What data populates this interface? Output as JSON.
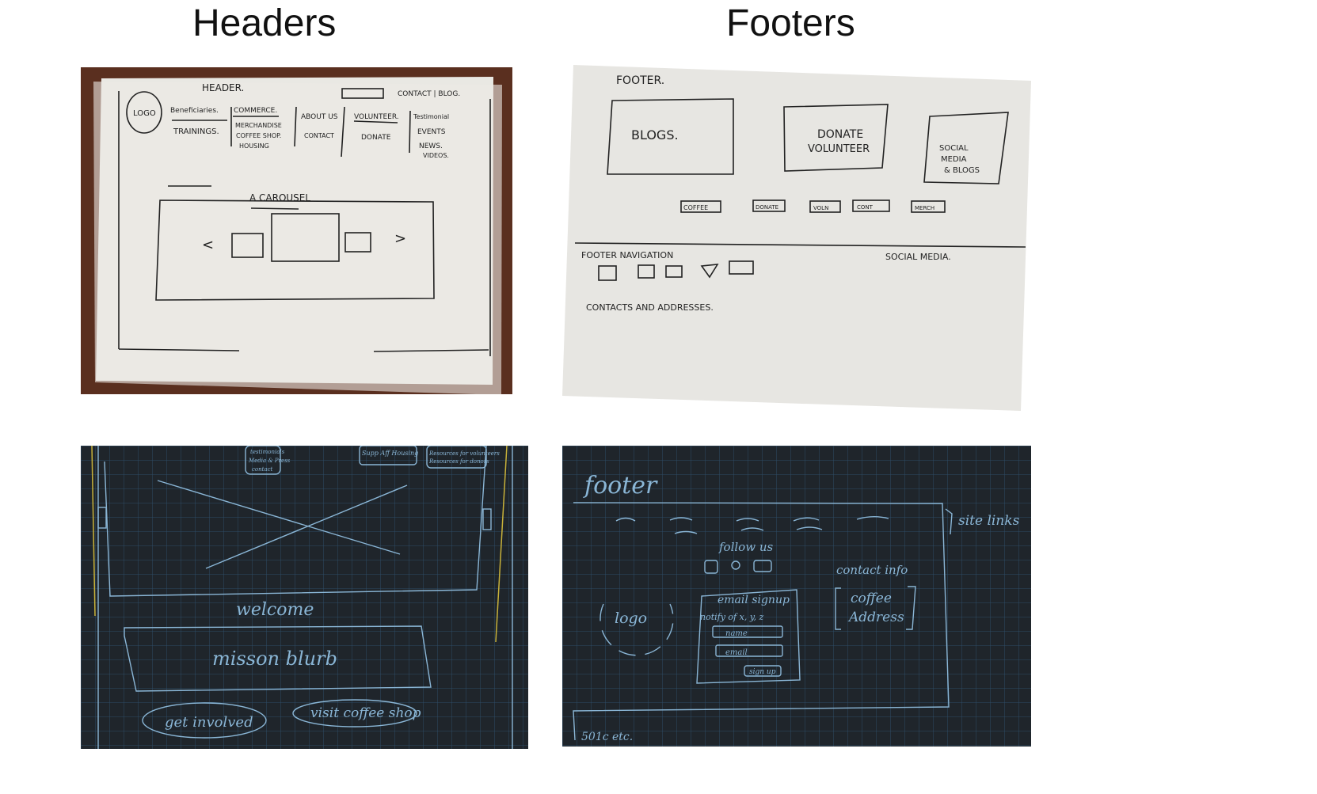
{
  "columns": {
    "left_title": "Headers",
    "right_title": "Footers"
  },
  "header_paper": {
    "title": "HEADER.",
    "logo": "LOGO",
    "top_links": "CONTACT | BLOG.",
    "nav": {
      "col1": [
        "Beneficiaries.",
        "TRAININGS."
      ],
      "col2": [
        "COMMERCE.",
        "MERCHANDISE",
        "COFFEE SHOP.",
        "HOUSING"
      ],
      "col3": [
        "ABOUT US",
        "CONTACT"
      ],
      "col4": [
        "VOLUNTEER.",
        "DONATE"
      ],
      "col5": [
        "Testimonial",
        "EVENTS",
        "NEWS.",
        "VIDEOS."
      ]
    },
    "carousel_label": "A CAROUSEL",
    "prev_arrow": "<",
    "next_arrow": ">"
  },
  "footer_paper": {
    "title": "FOOTER.",
    "box_blogs": "BLOGS.",
    "box_donate": [
      "DONATE",
      "VOLUNTEER"
    ],
    "box_social": [
      "SOCIAL",
      "MEDIA",
      "& BLOGS"
    ],
    "small_buttons": [
      "COFFEE",
      "DONATE",
      "VOLN",
      "CONT",
      "MERCH"
    ],
    "nav_label": "FOOTER NAVIGATION",
    "social_label": "SOCIAL MEDIA.",
    "contacts_label": "CONTACTS AND ADDRESSES."
  },
  "header_dark": {
    "top_boxes": [
      [
        "testimonials",
        "Media & Press",
        "contact"
      ],
      [
        "Supp Aff Housing"
      ],
      [
        "Resources for volunteers",
        "Resources for donors"
      ]
    ],
    "welcome": "welcome",
    "mission": "misson blurb",
    "btn_get_involved": "get involved",
    "btn_visit_coffee": "visit coffee shop"
  },
  "footer_dark": {
    "title": "footer",
    "site_links": "site links",
    "follow_us": "follow us",
    "contact_info": "contact info",
    "logo": "logo",
    "email_signup": "email signup",
    "notify": "notify of x, y, z",
    "name_field": "name",
    "email_field": "email",
    "signup_btn": "sign up",
    "coffee": "coffee",
    "address": "Address",
    "legal": "501c etc."
  },
  "colors": {
    "dark_bg": "#1f252b",
    "grid": "#2e4c66",
    "sketch_line": "#8ab6d6",
    "yellow_edge": "#c8b23a",
    "paper": "#ecebe6",
    "wood": "#5a2f1f",
    "ink": "#222"
  }
}
